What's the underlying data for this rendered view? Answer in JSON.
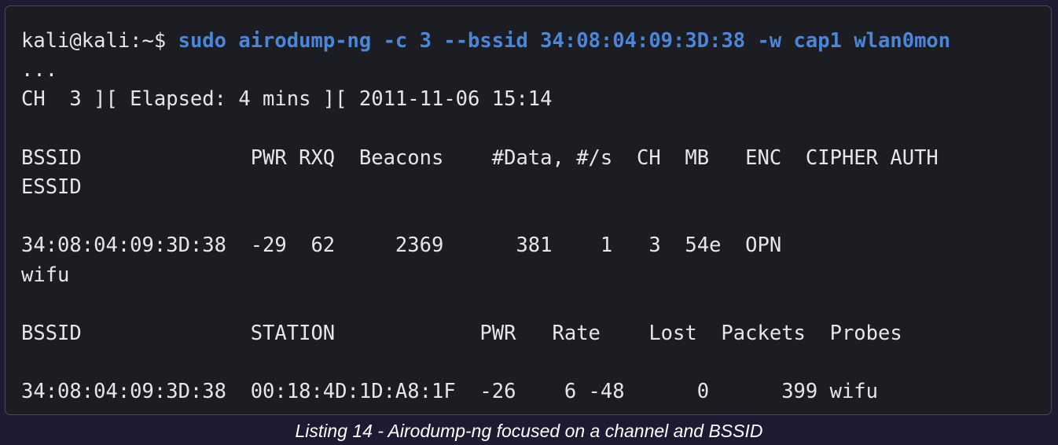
{
  "terminal": {
    "prompt": "kali@kali:~$ ",
    "command": "sudo airodump-ng -c 3 --bssid 34:08:04:09:3D:38 -w cap1 wlan0mon",
    "lines": [
      "...",
      "CH  3 ][ Elapsed: 4 mins ][ 2011-11-06 15:14",
      "",
      "BSSID              PWR RXQ  Beacons    #Data, #/s  CH  MB   ENC  CIPHER AUTH",
      "ESSID",
      "",
      "34:08:04:09:3D:38  -29  62     2369      381    1   3  54e  OPN",
      "wifu",
      "",
      "BSSID              STATION            PWR   Rate    Lost  Packets  Probes",
      "",
      "34:08:04:09:3D:38  00:18:4D:1D:A8:1F  -26    6 -48      0      399 wifu"
    ]
  },
  "caption": "Listing 14 - Airodump-ng focused on a channel and BSSID",
  "colors": {
    "page_background": "#1e1a32",
    "terminal_background": "#1c1d23",
    "text": "#e6e6e6",
    "command": "#4a86d9"
  }
}
